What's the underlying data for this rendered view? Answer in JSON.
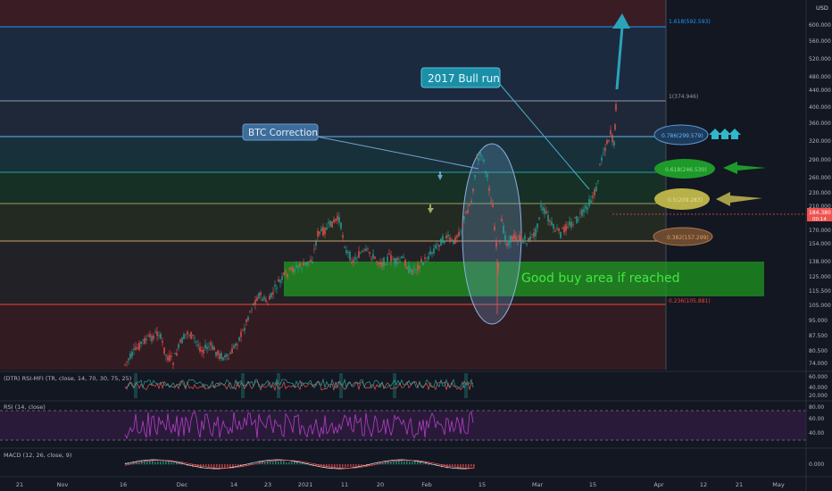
{
  "price_axis": {
    "currency": "USD",
    "ticks": [
      "600.000",
      "560.000",
      "520.000",
      "480.000",
      "440.000",
      "400.000",
      "360.000",
      "320.000",
      "290.000",
      "260.000",
      "230.000",
      "210.000",
      "190.000",
      "170.000",
      "154.000",
      "138.000",
      "125.000",
      "115.500",
      "105.000",
      "95.000",
      "87.500",
      "80.500",
      "74.000"
    ],
    "last_price": "184.380",
    "last_price_sub": "00:14"
  },
  "fib_levels": [
    {
      "label": "1.618(592.593)",
      "color": "#2196f3"
    },
    {
      "label": "1(374.946)",
      "color": "#9598a1"
    },
    {
      "label": "0.786(299.579)",
      "color": "#64b5f6"
    },
    {
      "label": "0.618(246.530)",
      "color": "#4caf50"
    },
    {
      "label": "0.5(209.283)",
      "color": "#c0b060"
    },
    {
      "label": "0.382(157.299)",
      "color": "#e0a060"
    },
    {
      "label": "0.236(105.881)",
      "color": "#f44336"
    }
  ],
  "annotations": {
    "correction": "BTC Correction",
    "bull_run": "2017 Bull run",
    "buy_area": "Good buy area if reached"
  },
  "indicators": {
    "dtr": {
      "title": "(DTR) RSI-MFI (TR, close, 14, 70, 30, 75, 25)",
      "ticks": [
        "60.000",
        "40.000",
        "20.000"
      ]
    },
    "rsi": {
      "title": "RSI (14, close)",
      "ticks": [
        "80.00",
        "60.00",
        "40.00"
      ]
    },
    "macd": {
      "title": "MACD (12, 26, close, 9)",
      "ticks": [
        "0.000"
      ]
    }
  },
  "time_axis": [
    "21",
    "Nov",
    "16",
    "Dec",
    "14",
    "23",
    "2021",
    "11",
    "20",
    "Feb",
    "15",
    "Mar",
    "15",
    "Apr",
    "12",
    "21",
    "May"
  ],
  "colors": {
    "up": "#26a69a",
    "down": "#ef5350",
    "background": "#131722"
  }
}
